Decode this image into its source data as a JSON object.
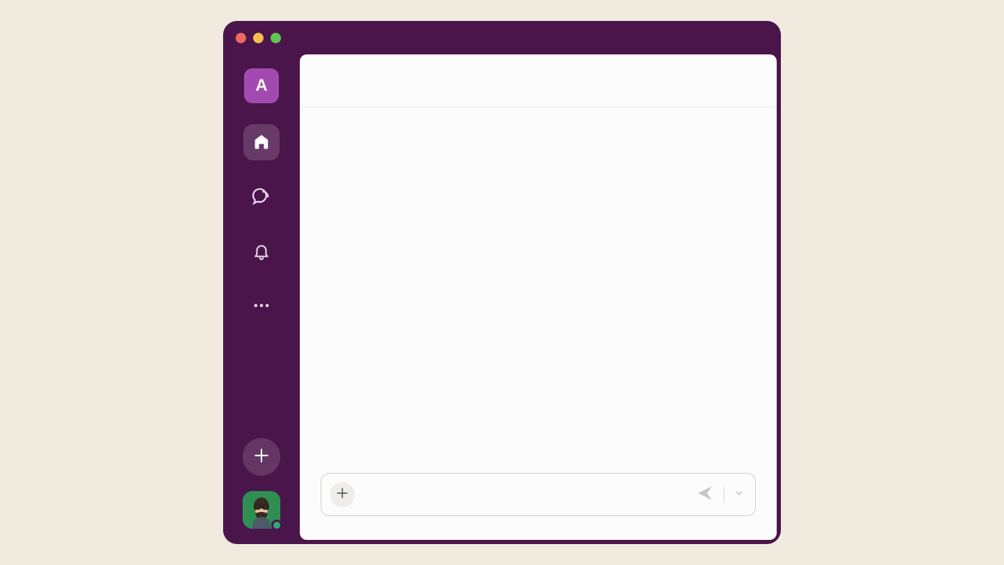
{
  "workspace": {
    "initial": "A"
  },
  "composer": {
    "placeholder": ""
  }
}
